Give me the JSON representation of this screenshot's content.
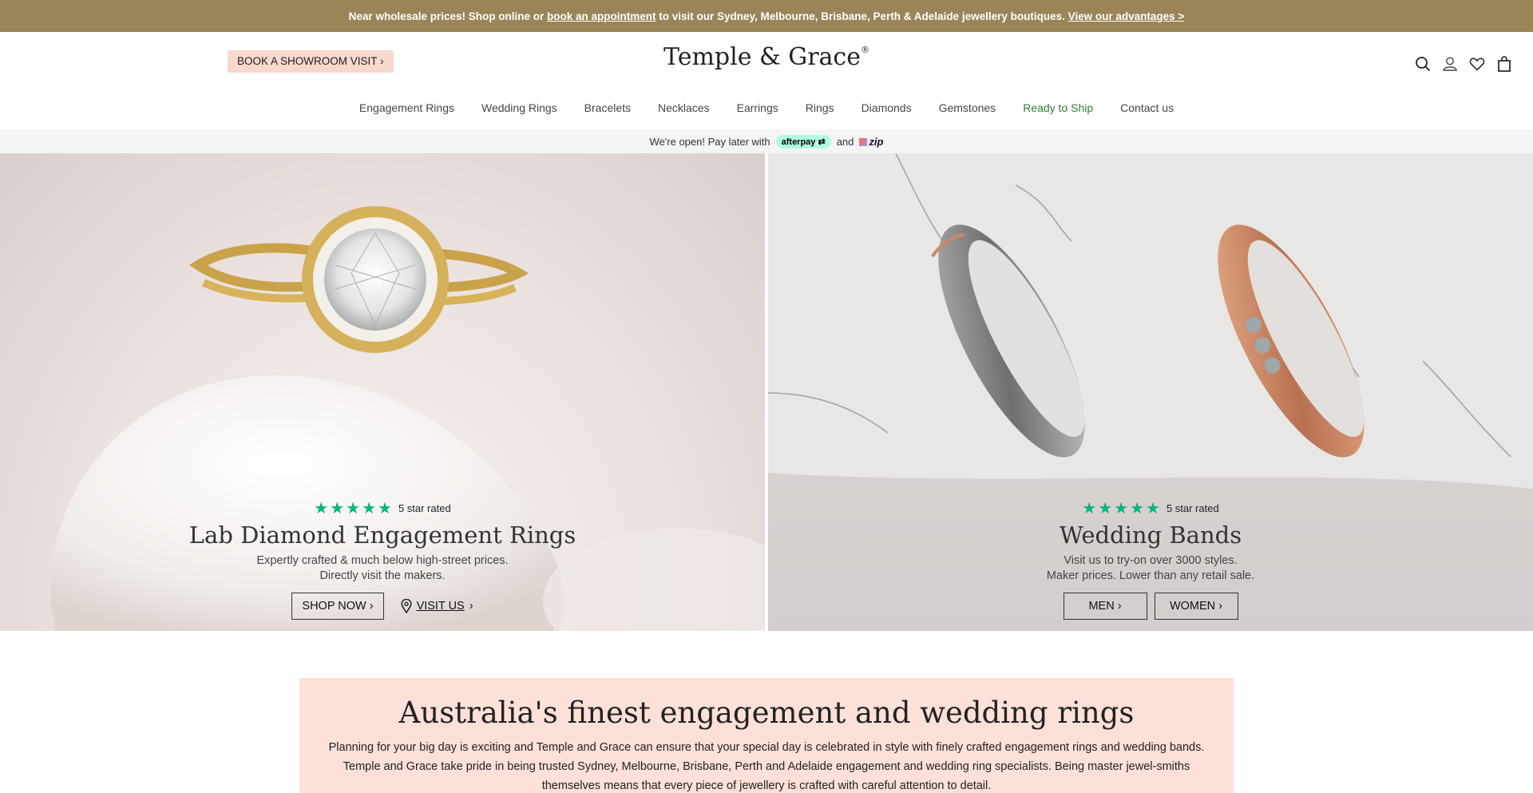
{
  "announcement": {
    "text_before": "Near wholesale prices! Shop online or ",
    "link_appointment": "book an appointment",
    "text_after": " to visit our Sydney, Melbourne, Brisbane, Perth & Adelaide jewellery boutiques. ",
    "link_advantages": "View our advantages >"
  },
  "header": {
    "book_visit_label": "BOOK A SHOWROOM VISIT",
    "logo_text": "Temple & Grace",
    "logo_mark": "®",
    "icons": [
      "search-icon",
      "account-icon",
      "heart-icon",
      "bag-icon"
    ]
  },
  "nav": {
    "items": [
      "Engagement Rings",
      "Wedding Rings",
      "Bracelets",
      "Necklaces",
      "Earrings",
      "Rings",
      "Diamonds",
      "Gemstones",
      "Ready to Ship",
      "Contact us"
    ],
    "highlight_color": "#2e7d32"
  },
  "paybar": {
    "text": "We're open! Pay later with",
    "afterpay": "afterpay",
    "and": "and",
    "zip": "zip"
  },
  "hero_left": {
    "stars": "★★★★★",
    "rating_text": "5 star rated",
    "title": "Lab Diamond Engagement Rings",
    "sub_line1": "Expertly crafted & much below high-street prices.",
    "sub_line2": "Directly visit the makers.",
    "shop_label": "SHOP NOW",
    "visit_label": "VISIT US"
  },
  "hero_right": {
    "stars": "★★★★★",
    "rating_text": "5 star rated",
    "title": "Wedding Bands",
    "sub_line1": "Visit us to try-on over 3000 styles.",
    "sub_line2": "Maker prices. Lower than any retail sale.",
    "men_label": "MEN",
    "women_label": "WOMEN"
  },
  "intro": {
    "title": "Australia's finest engagement and wedding rings",
    "body": "Planning for your big day is exciting and Temple and Grace can ensure that your special day is celebrated in style with finely crafted engagement rings and wedding bands. Temple and Grace take pride in being trusted Sydney, Melbourne, Brisbane, Perth and Adelaide engagement and wedding ring specialists. Being master jewel-smiths themselves means that every piece of jewellery is crafted with careful attention to detail."
  },
  "colors": {
    "announcement_bg": "#9a8559",
    "book_button_bg": "#f8d7cd",
    "intro_bg": "#fde0d7",
    "star_green": "#00b67a"
  }
}
